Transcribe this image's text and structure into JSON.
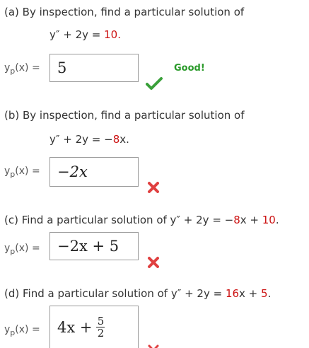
{
  "parts": [
    {
      "prompt": "(a) By inspection, find a particular solution of",
      "equation_lhs": "y″ + 2y  =  ",
      "equation_rhs": "10.",
      "label_y": "y",
      "label_sub": "p",
      "label_rest": "(x)  =",
      "answer": "5",
      "status_icon": "check-icon",
      "status_text": "Good!"
    },
    {
      "prompt": "(b) By inspection, find a particular solution of",
      "equation_lhs": "y″ + 2y  =  −",
      "equation_rhs": "8",
      "equation_tail": "x.",
      "label_y": "y",
      "label_sub": "p",
      "label_rest": "(x)  =",
      "answer": "−2x",
      "status_icon": "cross-icon"
    },
    {
      "prompt_prefix": "(c) Find a particular solution of y″ + 2y  =  −",
      "prompt_red1": "8",
      "prompt_mid": "x + ",
      "prompt_red2": "10",
      "prompt_end": ".",
      "label_y": "y",
      "label_sub": "p",
      "label_rest": "(x)  =",
      "answer": "−2x + 5",
      "status_icon": "cross-icon"
    },
    {
      "prompt_prefix": "(d) Find a particular solution of y″ + 2y  =  ",
      "prompt_red1": "16",
      "prompt_mid": "x + ",
      "prompt_red2": "5",
      "prompt_end": ".",
      "label_y": "y",
      "label_sub": "p",
      "label_rest": "(x)  =",
      "answer_main": "4x + ",
      "answer_num": "5",
      "answer_den": "2",
      "status_icon": "cross-icon"
    }
  ],
  "colors": {
    "correct": "#2a9a2a",
    "incorrect": "#e04040",
    "given_value": "#cc1111"
  }
}
